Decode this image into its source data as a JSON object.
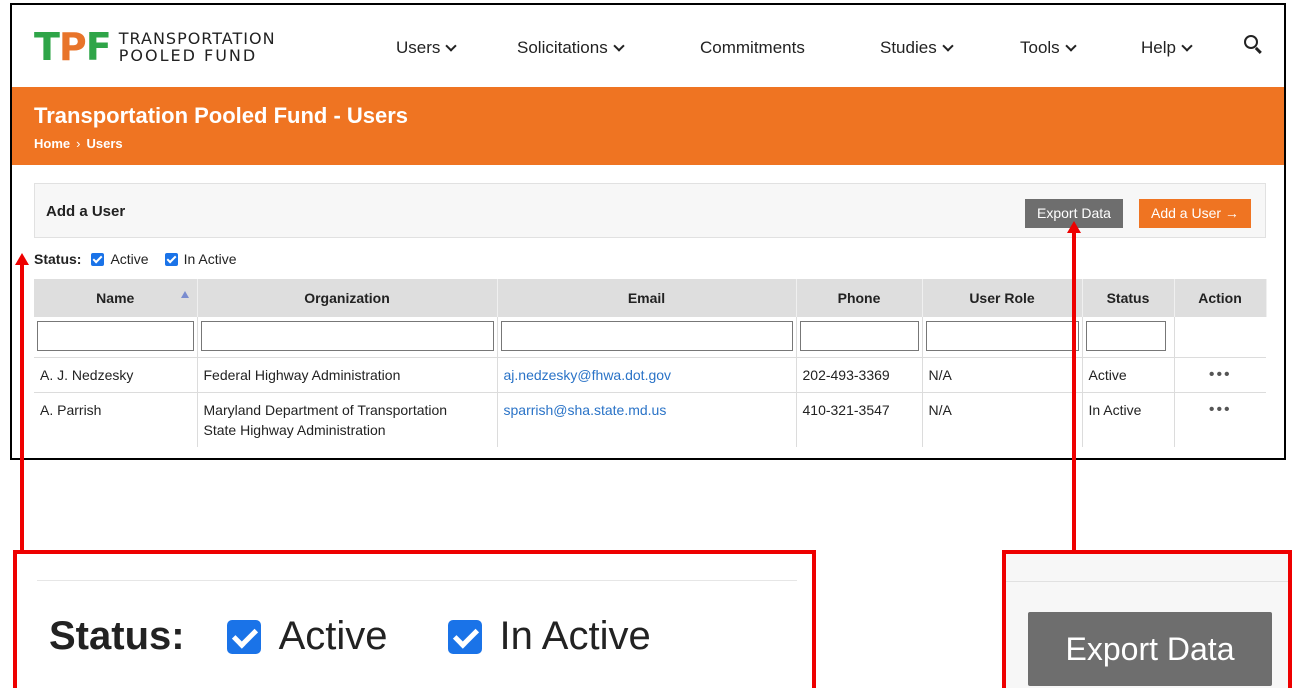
{
  "logo": {
    "mark_t": "T",
    "mark_p": "P",
    "mark_f": "F",
    "line1": "TRANSPORTATION",
    "line2": "POOLED FUND"
  },
  "nav": {
    "items": [
      {
        "label": "Users",
        "dropdown": true
      },
      {
        "label": "Solicitations",
        "dropdown": true
      },
      {
        "label": "Commitments",
        "dropdown": false
      },
      {
        "label": "Studies",
        "dropdown": true
      },
      {
        "label": "Tools",
        "dropdown": true
      },
      {
        "label": "Help",
        "dropdown": true
      }
    ],
    "search_icon": "search-icon"
  },
  "banner": {
    "title": "Transportation Pooled Fund - Users",
    "breadcrumb": [
      "Home",
      "Users"
    ],
    "breadcrumb_sep": "›",
    "color": "#ef7422"
  },
  "panel": {
    "title": "Add a User",
    "export_label": "Export Data",
    "add_label": "Add a User →"
  },
  "status": {
    "label": "Status:",
    "options": [
      {
        "label": "Active",
        "checked": true
      },
      {
        "label": "In Active",
        "checked": true
      }
    ]
  },
  "table": {
    "columns": [
      "Name",
      "Organization",
      "Email",
      "Phone",
      "User Role",
      "Status",
      "Action"
    ],
    "rows": [
      {
        "name": "A. J. Nedzesky",
        "organization": "Federal Highway Administration",
        "organization_line2": "",
        "email": "aj.nedzesky@fhwa.dot.gov",
        "phone": "202-493-3369",
        "role": "N/A",
        "status": "Active",
        "action": "•••"
      },
      {
        "name": "A. Parrish",
        "organization": "Maryland Department of Transportation",
        "organization_line2": "State Highway Administration",
        "email": "sparrish@sha.state.md.us",
        "phone": "410-321-3547",
        "role": "N/A",
        "status": "In Active",
        "action": "•••"
      }
    ]
  },
  "zoom": {
    "status_label": "Status:",
    "active_label": "Active",
    "inactive_label": "In Active",
    "export_label": "Export Data"
  },
  "colors": {
    "accent_orange": "#ef7422",
    "brand_green": "#2fa548",
    "export_gray": "#6e6e6e",
    "checkbox_blue": "#1a73e8",
    "callout_red": "#e00000",
    "link_blue": "#2a73c7"
  }
}
